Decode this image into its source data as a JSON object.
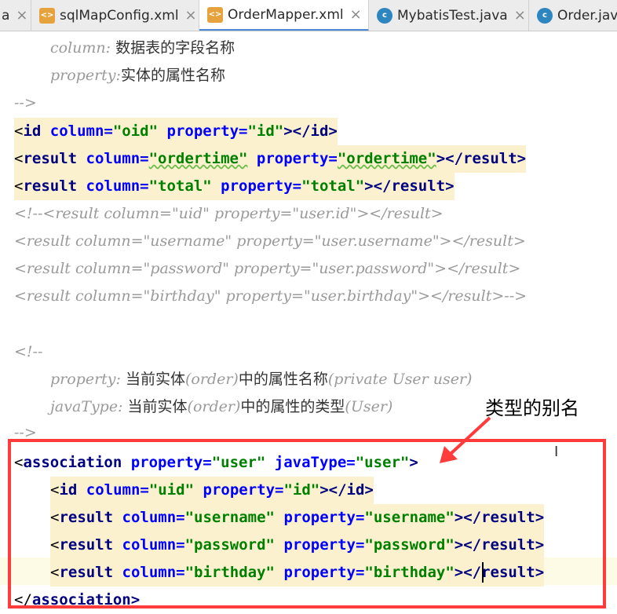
{
  "tabs": [
    {
      "label": "a",
      "icon": "none",
      "active": false
    },
    {
      "label": "sqlMapConfig.xml",
      "icon": "xml-file-icon",
      "active": false
    },
    {
      "label": "OrderMapper.xml",
      "icon": "xml-file-icon",
      "active": true
    },
    {
      "label": "MybatisTest.java",
      "icon": "java-class-icon",
      "active": false
    },
    {
      "label": "Order.jav",
      "icon": "java-class-icon",
      "active": false
    }
  ],
  "close_glyph": "×",
  "code": {
    "c1": {
      "key": "column:",
      "text": " 数据表的字段名称"
    },
    "c2": {
      "key": "property:",
      "text": "实体的属性名称"
    },
    "c3": "-->",
    "l_id": {
      "open": "<",
      "tag": "id",
      "attr1": " column=",
      "val1": "\"oid\"",
      "attr2": " property=",
      "val2": "\"id\"",
      "close": "></id>"
    },
    "l_ordertime": {
      "open": "<",
      "tag": "result",
      "attr1": " column=",
      "val1": "\"ordertime\"",
      "attr2": " property=",
      "val2": "\"ordertime\"",
      "close": "></result>"
    },
    "l_total": {
      "open": "<",
      "tag": "result",
      "attr1": " column=",
      "val1": "\"total\"",
      "attr2": " property=",
      "val2": "\"total\"",
      "close": "></result>"
    },
    "cm1": "<!--<result column=\"uid\" property=\"user.id\"></result>",
    "cm2": "<result column=\"username\" property=\"user.username\"></result>",
    "cm3": "<result column=\"password\" property=\"user.password\"></result>",
    "cm4": "<result column=\"birthday\" property=\"user.birthday\"></result>-->",
    "cm5": "<!--",
    "cm6": {
      "key": "property:",
      "t1": " 当前实体",
      "t2": "(order)",
      "t3": "中的属性名称",
      "t4": "(private User user)"
    },
    "cm7": {
      "key": "javaType:",
      "t1": " 当前实体",
      "t2": "(order)",
      "t3": "中的属性的类型",
      "t4": "(User)"
    },
    "cm8": "-->",
    "assoc": {
      "open": "<",
      "tag": "association",
      "attr1": " property=",
      "val1": "\"user\"",
      "attr2": " javaType=",
      "val2": "\"user\"",
      "close": ">"
    },
    "a_id": {
      "open": "<",
      "tag": "id",
      "attr1": " column=",
      "val1": "\"uid\"",
      "attr2": " property=",
      "val2": "\"id\"",
      "close": "></id>"
    },
    "a_username": {
      "open": "<",
      "tag": "result",
      "attr1": " column=",
      "val1": "\"username\"",
      "attr2": " property=",
      "val2": "\"username\"",
      "close": "></result>"
    },
    "a_password": {
      "open": "<",
      "tag": "result",
      "attr1": " column=",
      "val1": "\"password\"",
      "attr2": " property=",
      "val2": "\"password\"",
      "close": "></result>"
    },
    "a_birthday": {
      "open": "<",
      "tag": "result",
      "attr1": " column=",
      "val1": "\"birthday\"",
      "attr2": " property=",
      "val2": "\"birthday\"",
      "close": "></result>"
    },
    "a_end": {
      "open": "</",
      "tag": "association",
      "close": ">"
    }
  },
  "annotation": {
    "label": "类型的别名",
    "box_color": "#ff3b3b"
  },
  "colors": {
    "tag": "#000080",
    "attr": "#0000ff",
    "value": "#008000",
    "comment": "#9a9a9a",
    "highlight": "#fbf1cf",
    "accent": "#4a8bd6"
  }
}
